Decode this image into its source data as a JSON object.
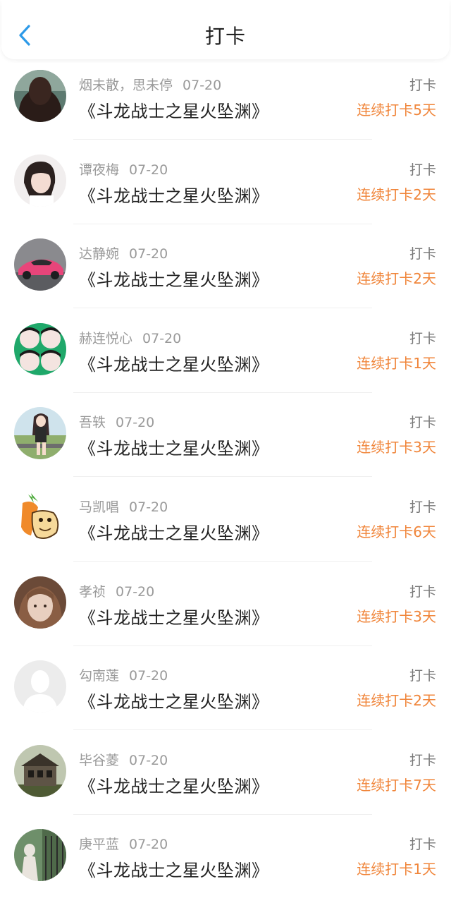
{
  "header": {
    "title": "打卡",
    "back_icon": "chevron-left-icon",
    "accent": "#2d9ae8"
  },
  "accent_orange": "#f0853a",
  "rows": [
    {
      "user": "烟未散，思未停",
      "date": "07-20",
      "book": "《斗龙战士之星火坠渊》",
      "type": "打卡",
      "streak": "连续打卡5天",
      "avatar": "long-dark-hair-portrait"
    },
    {
      "user": "谭夜梅",
      "date": "07-20",
      "book": "《斗龙战士之星火坠渊》",
      "type": "打卡",
      "streak": "连续打卡2天",
      "avatar": "girl-white-top"
    },
    {
      "user": "达静婉",
      "date": "07-20",
      "book": "《斗龙战士之星火坠渊》",
      "type": "打卡",
      "streak": "连续打卡2天",
      "avatar": "pink-sports-car"
    },
    {
      "user": "赫连悦心",
      "date": "07-20",
      "book": "《斗龙战士之星火坠渊》",
      "type": "打卡",
      "streak": "连续打卡1天",
      "avatar": "green-faces-collage"
    },
    {
      "user": "吾轶",
      "date": "07-20",
      "book": "《斗龙战士之星火坠渊》",
      "type": "打卡",
      "streak": "连续打卡3天",
      "avatar": "anime-girl-outdoor"
    },
    {
      "user": "马凯唱",
      "date": "07-20",
      "book": "《斗龙战士之星火坠渊》",
      "type": "打卡",
      "streak": "连续打卡6天",
      "avatar": "carrot-cartoon"
    },
    {
      "user": "孝祯",
      "date": "07-20",
      "book": "《斗龙战士之星火坠渊》",
      "type": "打卡",
      "streak": "连续打卡3天",
      "avatar": "brown-hair-sketch"
    },
    {
      "user": "勾南莲",
      "date": "07-20",
      "book": "《斗龙战士之星火坠渊》",
      "type": "打卡",
      "streak": "连续打卡2天",
      "avatar": "default-user-silhouette"
    },
    {
      "user": "毕谷菱",
      "date": "07-20",
      "book": "《斗龙战士之星火坠渊》",
      "type": "打卡",
      "streak": "连续打卡7天",
      "avatar": "old-building"
    },
    {
      "user": "庚平蓝",
      "date": "07-20",
      "book": "《斗龙战士之星火坠渊》",
      "type": "打卡",
      "streak": "连续打卡1天",
      "avatar": "garden-gate-figure"
    }
  ]
}
